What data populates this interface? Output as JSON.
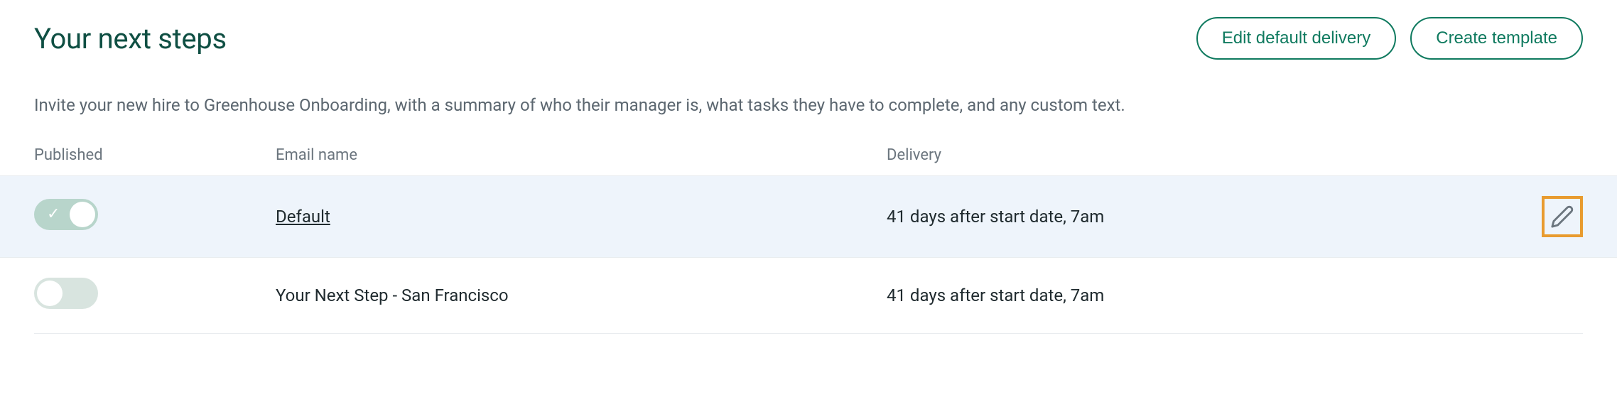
{
  "header": {
    "title": "Your next steps",
    "edit_default_delivery_label": "Edit default delivery",
    "create_template_label": "Create template"
  },
  "description": "Invite your new hire to Greenhouse Onboarding, with a summary of who their manager is, what tasks they have to complete, and any custom text.",
  "table": {
    "columns": {
      "published": "Published",
      "email_name": "Email name",
      "delivery": "Delivery"
    },
    "rows": [
      {
        "published": true,
        "name": "Default",
        "delivery": "41 days after start date, 7am",
        "highlighted": true,
        "edit_visible": true
      },
      {
        "published": false,
        "name": "Your Next Step - San Francisco",
        "delivery": "41 days after start date, 7am",
        "highlighted": false,
        "edit_visible": false
      }
    ]
  }
}
